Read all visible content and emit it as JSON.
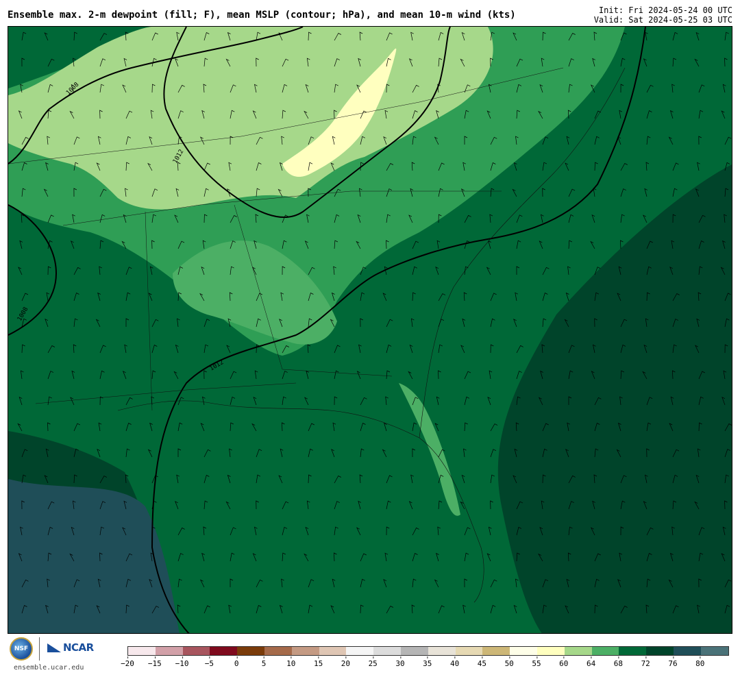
{
  "header": {
    "title": "Ensemble max. 2-m dewpoint (fill; F), mean MSLP (contour; hPa), and mean 10-m wind (kts)",
    "init": "Init: Fri 2024-05-24 00 UTC",
    "valid": "Valid: Sat 2024-05-25 03 UTC"
  },
  "map": {
    "isobar_labels": [
      "1008",
      "1012",
      "1008",
      "1012"
    ],
    "colors": {
      "deep": "#00442a",
      "dark": "#006837",
      "mid": "#2f9e55",
      "light": "#4caf65",
      "pale": "#a6d88a",
      "cream": "#ffffbf",
      "water_teal": "#1f4e58"
    }
  },
  "footer": {
    "logo_nsf": "NSF",
    "logo_ncar": "NCAR",
    "site": "ensemble.ucar.edu"
  },
  "colorbar": {
    "colors": [
      "#f7e8ec",
      "#d2a0a8",
      "#a8555e",
      "#7f0a1d",
      "#7a3b0a",
      "#a56a4a",
      "#c49a83",
      "#dfc6b4",
      "#f5f5f5",
      "#dcdcdc",
      "#b5b5b5",
      "#e8e3d8",
      "#e6d9b3",
      "#cdb777",
      "#fefee8",
      "#ffffbf",
      "#a6d88a",
      "#4caf65",
      "#006837",
      "#00442a",
      "#1f4e58",
      "#4a7278"
    ],
    "ticks": [
      "−20",
      "−15",
      "−10",
      "−5",
      "0",
      "5",
      "10",
      "15",
      "20",
      "25",
      "30",
      "35",
      "40",
      "45",
      "50",
      "55",
      "60",
      "64",
      "68",
      "72",
      "76",
      "80"
    ]
  }
}
